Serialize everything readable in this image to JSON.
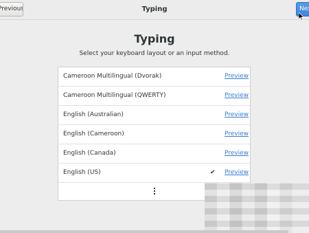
{
  "header": {
    "previous_label": "Previous",
    "title": "Typing",
    "next_label": "Next"
  },
  "main": {
    "title": "Typing",
    "subtitle": "Select your keyboard layout or an input method."
  },
  "layouts": [
    {
      "label": "Cameroon Multilingual (Dvorak)",
      "preview": "Preview",
      "selected": false
    },
    {
      "label": "Cameroon Multilingual (QWERTY)",
      "preview": "Preview",
      "selected": false
    },
    {
      "label": "English (Australian)",
      "preview": "Preview",
      "selected": false
    },
    {
      "label": "English (Cameroon)",
      "preview": "Preview",
      "selected": false
    },
    {
      "label": "English (Canada)",
      "preview": "Preview",
      "selected": false
    },
    {
      "label": "English (US)",
      "preview": "Preview",
      "selected": true,
      "check": "✔"
    }
  ],
  "icons": {
    "more": "vertical-ellipsis-icon",
    "check": "checkmark-icon",
    "cursor": "mouse-pointer-icon"
  },
  "colors": {
    "accent": "#3f86d9",
    "link": "#3a7bd5",
    "background": "#ededed"
  }
}
